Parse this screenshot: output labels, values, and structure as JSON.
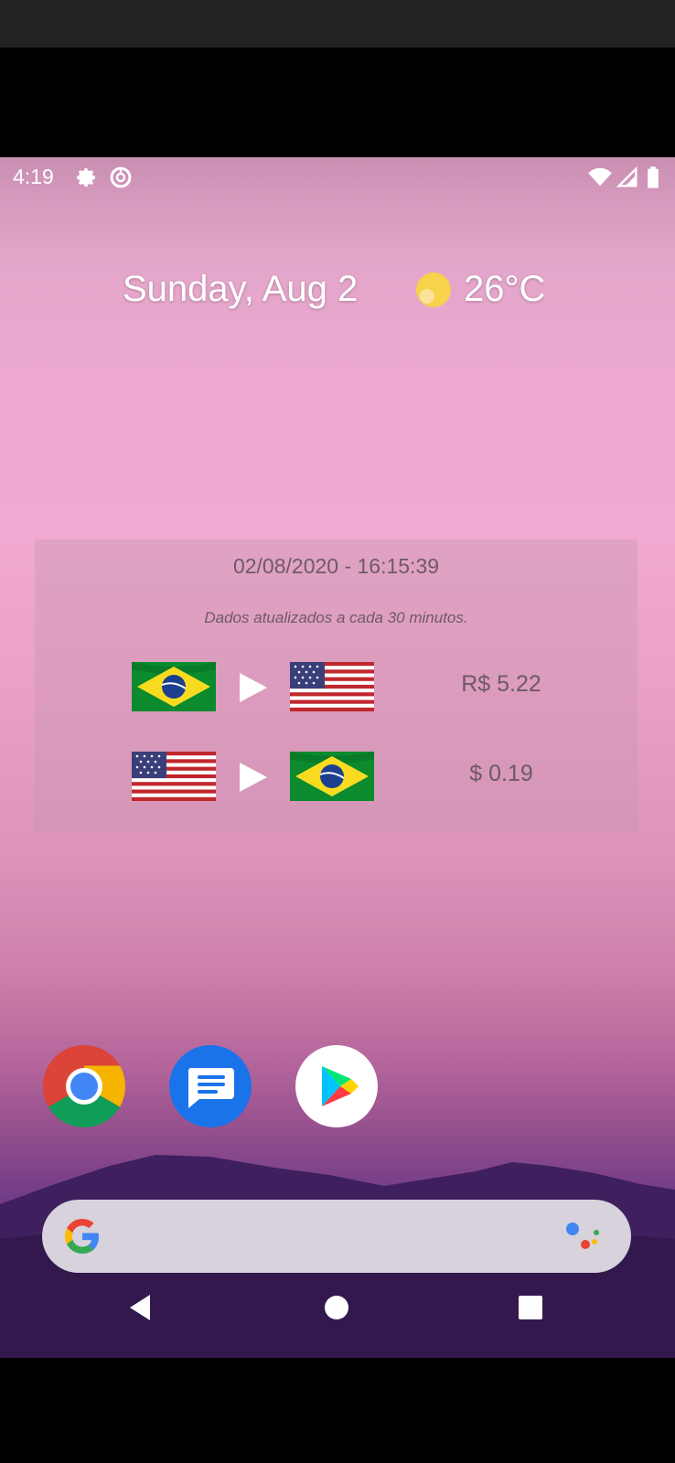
{
  "status_bar": {
    "time": "4:19",
    "icons": [
      "gear-icon",
      "data-saver-icon",
      "wifi-icon",
      "signal-icon",
      "battery-icon"
    ]
  },
  "header": {
    "date": "Sunday, Aug 2",
    "weather_icon": "sun-icon",
    "temperature": "26°C"
  },
  "widget": {
    "timestamp": "02/08/2020 - 16:15:39",
    "note": "Dados atualizados a cada 30 minutos.",
    "rows": [
      {
        "from_flag": "brazil-flag",
        "to_flag": "usa-flag",
        "rate": "R$ 5.22"
      },
      {
        "from_flag": "usa-flag",
        "to_flag": "brazil-flag",
        "rate": "$ 0.19"
      }
    ]
  },
  "dock": {
    "apps": [
      "chrome-icon",
      "messages-icon",
      "play-store-icon"
    ]
  },
  "search_bar": {
    "logo": "google-g-icon",
    "assistant": "assistant-icon"
  },
  "nav_bar": {
    "buttons": [
      "back-button",
      "home-button",
      "recents-button"
    ]
  },
  "colors": {
    "accent_blue": "#1a73e8",
    "widget_text": "#6e5a64"
  }
}
